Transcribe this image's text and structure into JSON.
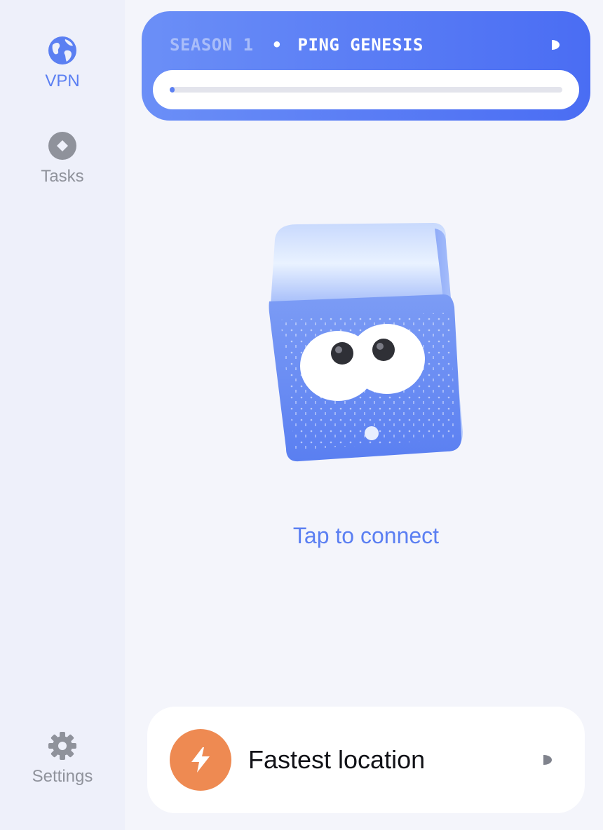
{
  "sidebar": {
    "items": [
      {
        "id": "vpn",
        "label": "VPN",
        "icon": "globe-icon",
        "active": true
      },
      {
        "id": "tasks",
        "label": "Tasks",
        "icon": "diamond-icon",
        "active": false
      }
    ],
    "settings": {
      "label": "Settings",
      "icon": "gear-icon"
    }
  },
  "season": {
    "label": "SEASON 1",
    "separator": "•",
    "name": "PING GENESIS",
    "progress": 0.01
  },
  "main": {
    "mascot": "cube-mascot",
    "connect_label": "Tap to connect"
  },
  "location": {
    "label": "Fastest location",
    "icon": "lightning-bolt-icon"
  },
  "colors": {
    "accent": "#5b7ff2",
    "inactive": "#8f929b",
    "bolt_bg": "#ee8a52",
    "background": "#f4f5fb",
    "sidebar_bg": "#eef0fa"
  }
}
